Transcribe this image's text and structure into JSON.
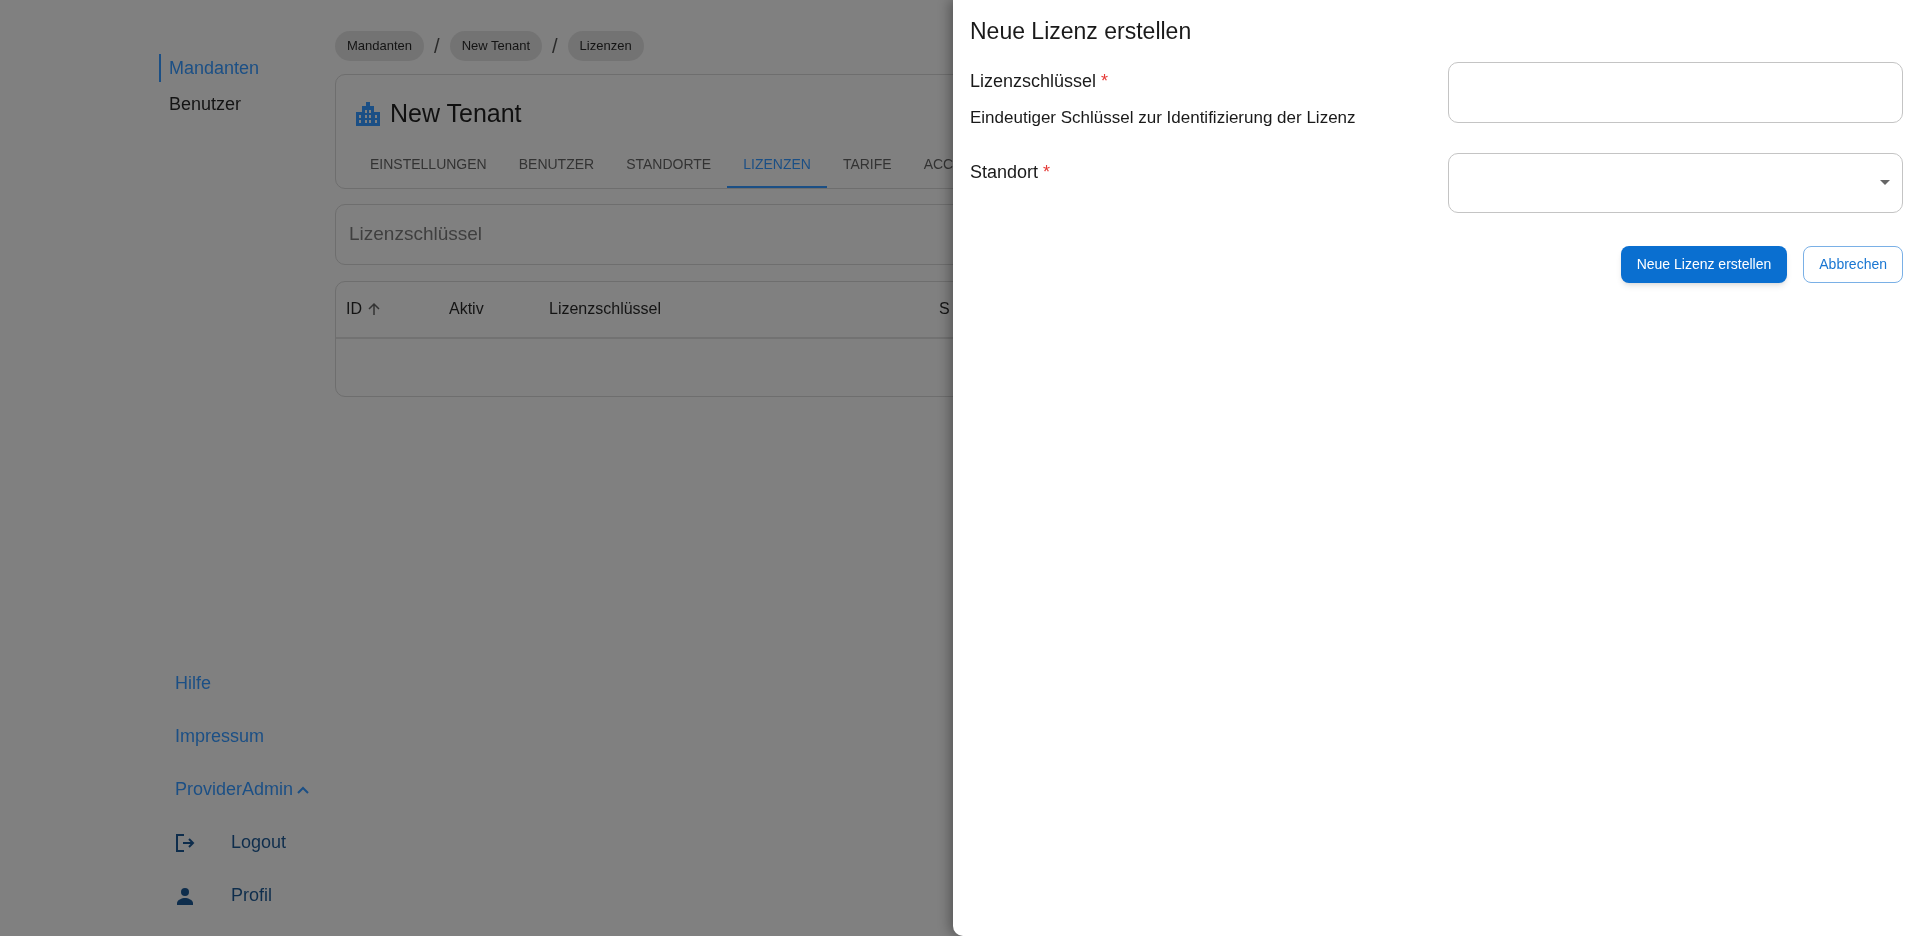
{
  "sidebar": {
    "nav": [
      {
        "label": "Mandanten",
        "selected": true
      },
      {
        "label": "Benutzer",
        "selected": false
      }
    ],
    "footer_links": [
      {
        "label": "Hilfe"
      },
      {
        "label": "Impressum"
      }
    ],
    "user_menu": {
      "label": "ProviderAdmin",
      "expanded": true,
      "items": [
        {
          "kind": "logout",
          "label": "Logout"
        },
        {
          "kind": "profile",
          "label": "Profil"
        }
      ]
    }
  },
  "breadcrumbs": [
    {
      "kind": "crumb",
      "label": "Mandanten"
    },
    {
      "kind": "separator",
      "label": "/"
    },
    {
      "kind": "crumb",
      "label": "New Tenant"
    },
    {
      "kind": "separator",
      "label": "/"
    },
    {
      "kind": "crumb",
      "label": "Lizenzen"
    }
  ],
  "tenant": {
    "title": "New Tenant",
    "tabs": [
      {
        "label": "EINSTELLUNGEN",
        "selected": false
      },
      {
        "label": "BENUTZER",
        "selected": false
      },
      {
        "label": "STANDORTE",
        "selected": false
      },
      {
        "label": "LIZENZEN",
        "selected": true
      },
      {
        "label": "TARIFE",
        "selected": false
      },
      {
        "label": "ACC",
        "selected": false
      }
    ]
  },
  "search": {
    "placeholder": "Lizenzschlüssel"
  },
  "table": {
    "columns": [
      {
        "label": "ID",
        "sorted_ascending": true
      },
      {
        "label": "Aktiv"
      },
      {
        "label": "Lizenzschlüssel"
      },
      {
        "label": "S"
      }
    ]
  },
  "dialog": {
    "title": "Neue Lizenz erstellen",
    "fields": [
      {
        "kind": "text",
        "label": "Lizenzschlüssel",
        "required_mark": "*",
        "description": "Eindeutiger Schlüssel zur Identifizierung der Lizenz"
      },
      {
        "kind": "select",
        "label": "Standort",
        "required_mark": "*"
      }
    ],
    "buttons": [
      {
        "kind": "primary",
        "label": "Neue Lizenz erstellen"
      },
      {
        "kind": "secondary",
        "label": "Abbrechen"
      }
    ]
  }
}
